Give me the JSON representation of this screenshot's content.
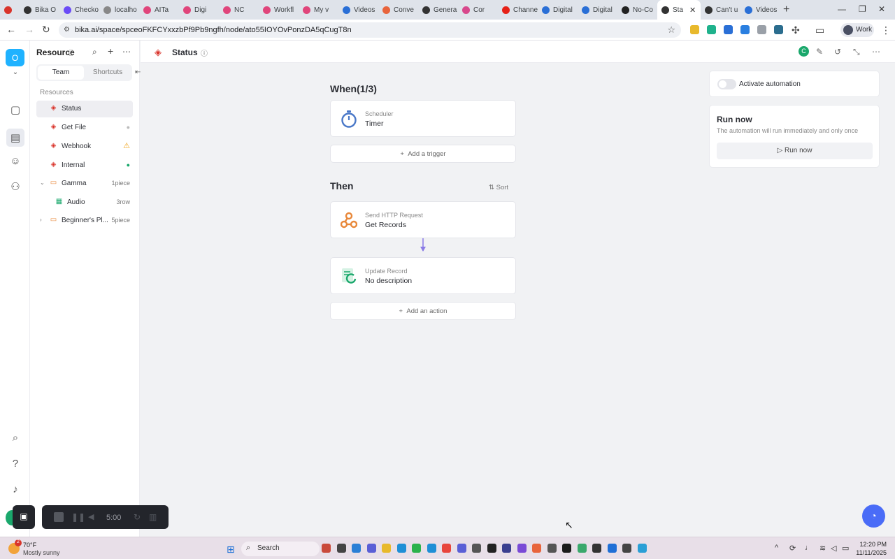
{
  "browser": {
    "tabs": [
      {
        "label": "",
        "color": "#d9342b"
      },
      {
        "label": "Bika O",
        "color": "#333333"
      },
      {
        "label": "Checko",
        "color": "#6b4cf6"
      },
      {
        "label": "localho",
        "color": "#888888"
      },
      {
        "label": "AITa",
        "color": "#e0457b"
      },
      {
        "label": "Digi",
        "color": "#e0457b"
      },
      {
        "label": "NC",
        "color": "#e0457b"
      },
      {
        "label": "Workfl",
        "color": "#e0457b"
      },
      {
        "label": "My v",
        "color": "#e0457b"
      },
      {
        "label": "Videos",
        "color": "#2a6fd6"
      },
      {
        "label": "Conve",
        "color": "#e8643c"
      },
      {
        "label": "Genera",
        "color": "#333333"
      },
      {
        "label": "Cor",
        "color": "#d8488c"
      },
      {
        "label": "Channe",
        "color": "#e62117"
      },
      {
        "label": "Digital",
        "color": "#2a6fd6"
      },
      {
        "label": "Digital",
        "color": "#2a6fd6"
      },
      {
        "label": "No-Co",
        "color": "#222222"
      },
      {
        "label": "Sta",
        "color": "#333333",
        "active": true
      },
      {
        "label": "Can't u",
        "color": "#333333"
      },
      {
        "label": "Videos",
        "color": "#2a6fd6"
      }
    ],
    "url": "bika.ai/space/spceoFKFCYxxzbPf9Pb9ngfh/node/ato55IOYOvPonzDA5qCugT8n",
    "profile_label": "Work"
  },
  "rail": {
    "space_initial": "O"
  },
  "sidebar": {
    "title": "Resource",
    "tabs": [
      "Team",
      "Shortcuts"
    ],
    "section_label": "Resources",
    "items": [
      {
        "label": "Status",
        "selected": true
      },
      {
        "label": "Get File",
        "count": ""
      },
      {
        "label": "Webhook"
      },
      {
        "label": "Internal"
      },
      {
        "label": "Gamma",
        "count": "1piece"
      },
      {
        "label": "Audio",
        "count": "3row"
      },
      {
        "label": "Beginner's Pl...",
        "count": "5piece"
      }
    ]
  },
  "header": {
    "title": "Status",
    "avatar_initial": "C"
  },
  "automation": {
    "when_title": "When(1/3)",
    "trigger": {
      "type": "Scheduler",
      "name": "Timer"
    },
    "add_trigger": "Add a trigger",
    "then_title": "Then",
    "sort_label": "Sort",
    "actions": [
      {
        "type": "Send HTTP Request",
        "name": "Get Records"
      },
      {
        "type": "Update Record",
        "name": "No description"
      }
    ],
    "add_action": "Add an action"
  },
  "panel": {
    "activate_label": "Activate automation",
    "run_title": "Run now",
    "run_desc": "The automation will run immediately and only once",
    "run_button": "Run now"
  },
  "recorder": {
    "time": "5:00"
  },
  "taskbar": {
    "weather_badge": "2",
    "weather_temp": "70°F",
    "weather_desc": "Mostly sunny",
    "search_placeholder": "Search",
    "clock_time": "12:20 PM",
    "clock_date": "11/11/2025"
  },
  "colors": {
    "accent": "#1fb2ff",
    "resource_red": "#d9342b",
    "folder_orange": "#e8883a",
    "sheet_green": "#1aa86c",
    "flow_connector": "#8a7be6",
    "warning": "#f0a51d"
  }
}
